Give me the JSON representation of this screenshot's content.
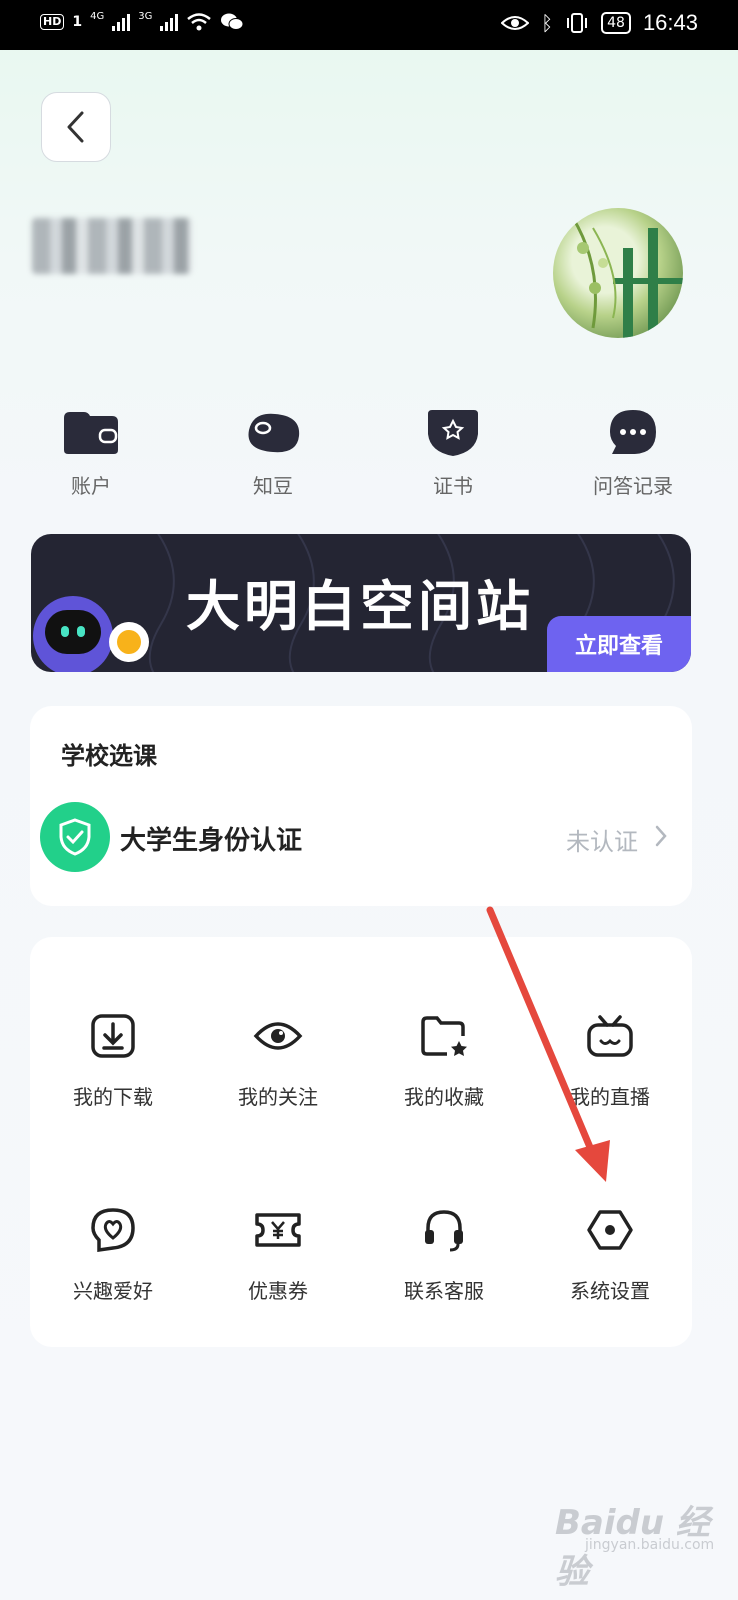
{
  "status_bar": {
    "hd": "HD",
    "sim": "1",
    "net1": "4G",
    "net2": "3G",
    "battery": "48",
    "time": "16:43"
  },
  "profile": {
    "back_icon": "chevron-left-icon",
    "avatar_desc": "avatar"
  },
  "quick_actions": [
    {
      "label": "账户",
      "icon": "wallet-icon"
    },
    {
      "label": "知豆",
      "icon": "bean-icon"
    },
    {
      "label": "证书",
      "icon": "certificate-icon"
    },
    {
      "label": "问答记录",
      "icon": "chat-icon"
    }
  ],
  "banner": {
    "title": "大明白空间站",
    "button": "立即查看"
  },
  "school": {
    "title": "学校选课",
    "verify_label": "大学生身份认证",
    "verify_status": "未认证"
  },
  "grid": [
    {
      "label": "我的下载",
      "icon": "download-icon"
    },
    {
      "label": "我的关注",
      "icon": "eye-icon"
    },
    {
      "label": "我的收藏",
      "icon": "folder-star-icon"
    },
    {
      "label": "我的直播",
      "icon": "tv-icon"
    },
    {
      "label": "兴趣爱好",
      "icon": "heart-pin-icon"
    },
    {
      "label": "优惠券",
      "icon": "coupon-icon"
    },
    {
      "label": "联系客服",
      "icon": "headset-icon"
    },
    {
      "label": "系统设置",
      "icon": "settings-icon"
    }
  ],
  "watermark": {
    "main": "Baidu 经验",
    "sub": "jingyan.baidu.com"
  },
  "colors": {
    "accent": "#6e63f0",
    "verify_green": "#22d08a",
    "arrow_red": "#e5483d",
    "banner_bg": "#242533"
  }
}
